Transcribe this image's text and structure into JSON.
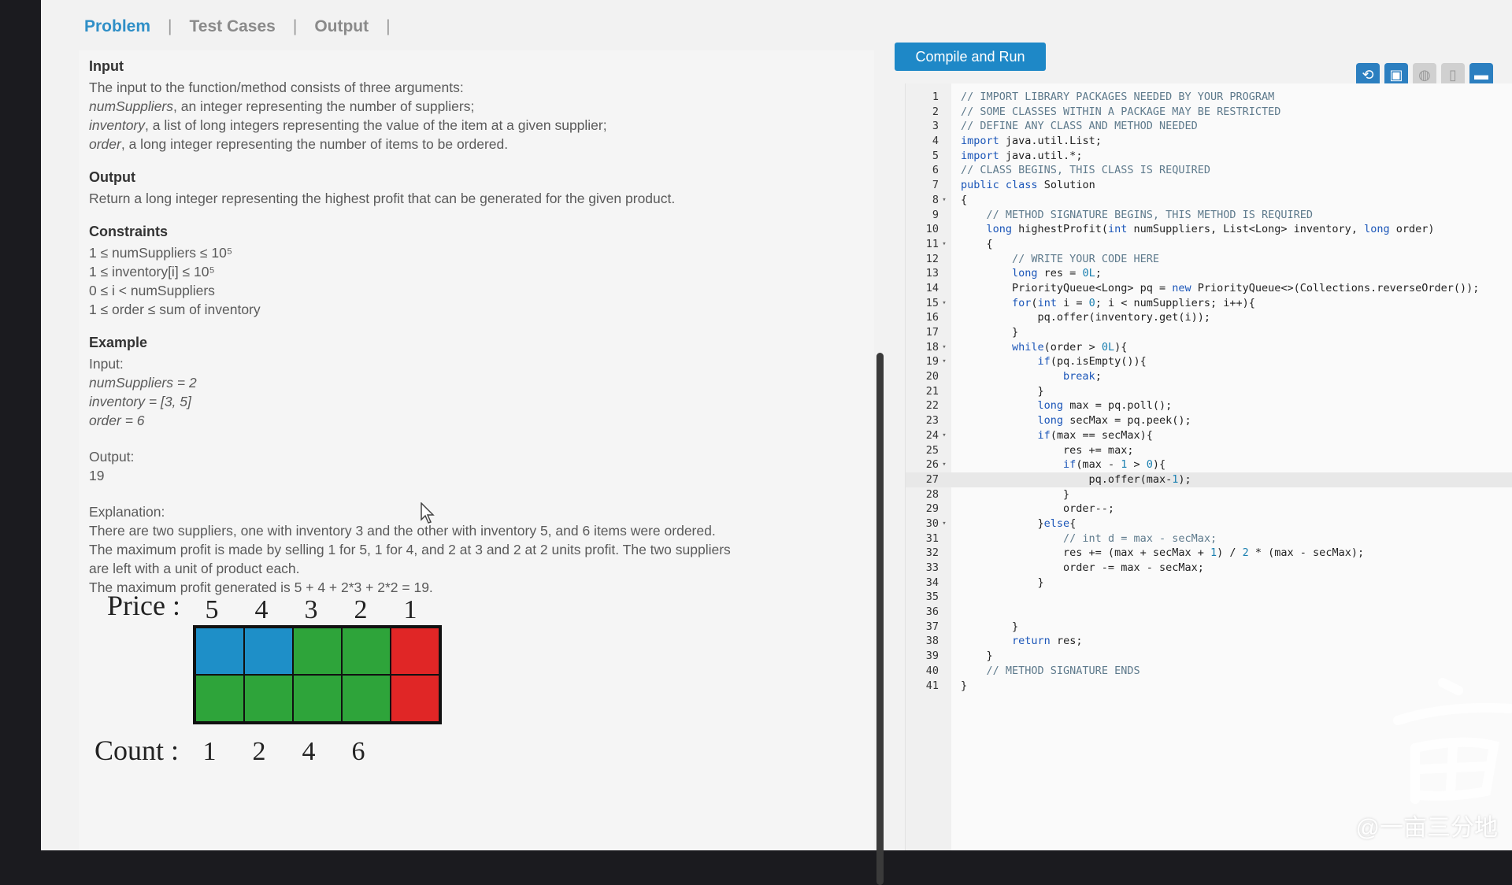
{
  "tabs": [
    {
      "label": "Problem"
    },
    {
      "label": "Test Cases"
    },
    {
      "label": "Output"
    }
  ],
  "problem": {
    "input_heading": "Input",
    "input_lines": [
      "The input to the function/method consists of three arguments:",
      {
        "var": "numSuppliers",
        "text": ", an integer representing the number of suppliers;"
      },
      {
        "var": "inventory",
        "text": ", a list of long integers representing the value of the item at a given supplier;"
      },
      {
        "var": "order",
        "text": ", a long integer representing the number of items to be ordered."
      }
    ],
    "output_heading": "Output",
    "output_text": "Return a long integer representing the highest profit that can be generated for the given product.",
    "constraints_heading": "Constraints",
    "constraints": [
      "1 ≤ numSuppliers ≤ 10⁵",
      "1 ≤ inventory[i] ≤ 10⁵",
      "0 ≤ i < numSuppliers",
      "1 ≤ order ≤ sum of inventory"
    ],
    "example_heading": "Example",
    "example_input_label": "Input:",
    "example_input": [
      "numSuppliers = 2",
      "inventory = [3, 5]",
      "order = 6"
    ],
    "example_output_label": "Output:",
    "example_output": "19",
    "explanation_label": "Explanation:",
    "explanation": [
      "There are two suppliers, one with inventory 3 and the other with inventory 5, and 6 items were ordered.",
      "The maximum profit is made by selling 1 for 5, 1 for 4, and 2 at 3 and 2 at 2 units profit.  The two suppliers",
      "are left with a unit of product each.",
      "The maximum profit generated is 5 + 4 + 2*3 + 2*2 = 19."
    ],
    "diagram": {
      "price_label": "Price :",
      "prices": [
        "5",
        "4",
        "3",
        "2",
        "1"
      ],
      "count_label": "Count :",
      "counts": [
        "1",
        "2",
        "4",
        "6"
      ],
      "colors": [
        "#1e8fc8",
        "#1e8fc8",
        "#2ea43a",
        "#2ea43a",
        "#e02626",
        "#2ea43a",
        "#2ea43a",
        "#2ea43a",
        "#2ea43a",
        "#e02626"
      ]
    }
  },
  "editor": {
    "compile_label": "Compile and Run",
    "toolbar_icons": [
      "reset-icon",
      "save-icon",
      "palette-icon",
      "layout-split-icon",
      "layout-bottom-icon"
    ],
    "lines": [
      "// IMPORT LIBRARY PACKAGES NEEDED BY YOUR PROGRAM",
      "// SOME CLASSES WITHIN A PACKAGE MAY BE RESTRICTED",
      "// DEFINE ANY CLASS AND METHOD NEEDED",
      "import java.util.List;",
      "import java.util.*;",
      "// CLASS BEGINS, THIS CLASS IS REQUIRED",
      "public class Solution",
      "{",
      "    // METHOD SIGNATURE BEGINS, THIS METHOD IS REQUIRED",
      "    long highestProfit(int numSuppliers, List<Long> inventory, long order)",
      "    {",
      "        // WRITE YOUR CODE HERE",
      "        long res = 0L;",
      "        PriorityQueue<Long> pq = new PriorityQueue<>(Collections.reverseOrder());",
      "        for(int i = 0; i < numSuppliers; i++){",
      "            pq.offer(inventory.get(i));",
      "        }",
      "        while(order > 0L){",
      "            if(pq.isEmpty()){",
      "                break;",
      "            }",
      "            long max = pq.poll();",
      "            long secMax = pq.peek();",
      "            if(max == secMax){",
      "                res += max;",
      "                if(max - 1 > 0){",
      "                    pq.offer(max-1);",
      "                }",
      "                order--;",
      "            }else{",
      "                // int d = max - secMax;",
      "                res += (max + secMax + 1) / 2 * (max - secMax);",
      "                order -= max - secMax;",
      "            }",
      "",
      "",
      "        }",
      "        return res;",
      "    }",
      "    // METHOD SIGNATURE ENDS",
      "}"
    ],
    "fold_lines": [
      8,
      11,
      15,
      18,
      19,
      24,
      26,
      30
    ],
    "highlight_line": 27
  },
  "watermark": "@一亩三分地"
}
